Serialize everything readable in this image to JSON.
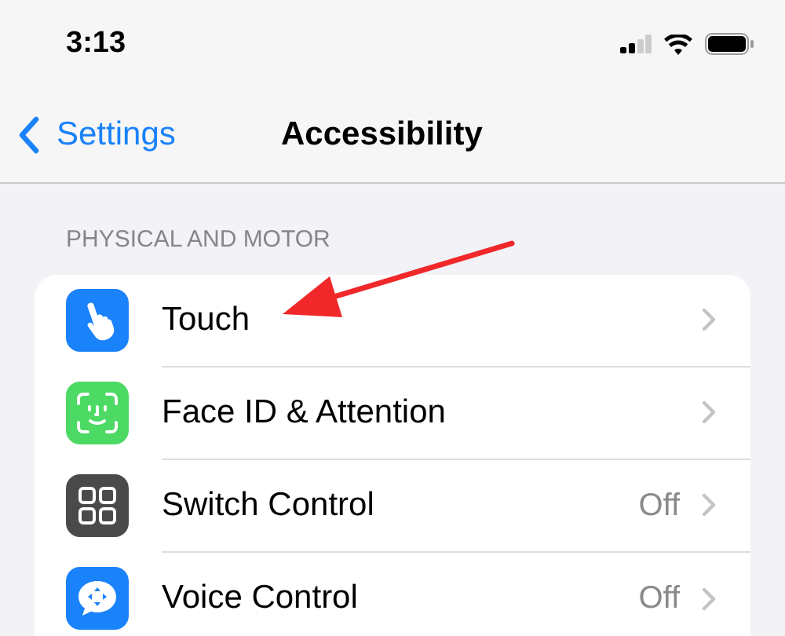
{
  "status_bar": {
    "time": "3:13"
  },
  "nav": {
    "back": "Settings",
    "title": "Accessibility"
  },
  "section": {
    "header": "PHYSICAL AND MOTOR",
    "rows": [
      {
        "kind": "touch",
        "label": "Touch",
        "color": "#1a82fb"
      },
      {
        "kind": "face",
        "label": "Face ID & Attention",
        "color": "#4cd964"
      },
      {
        "kind": "switch",
        "label": "Switch Control",
        "value": "Off",
        "color": "#4a4a4a"
      },
      {
        "kind": "voice",
        "label": "Voice Control",
        "value": "Off",
        "color": "#1a82fb"
      }
    ]
  },
  "annotation": {
    "kind": "arrow"
  }
}
